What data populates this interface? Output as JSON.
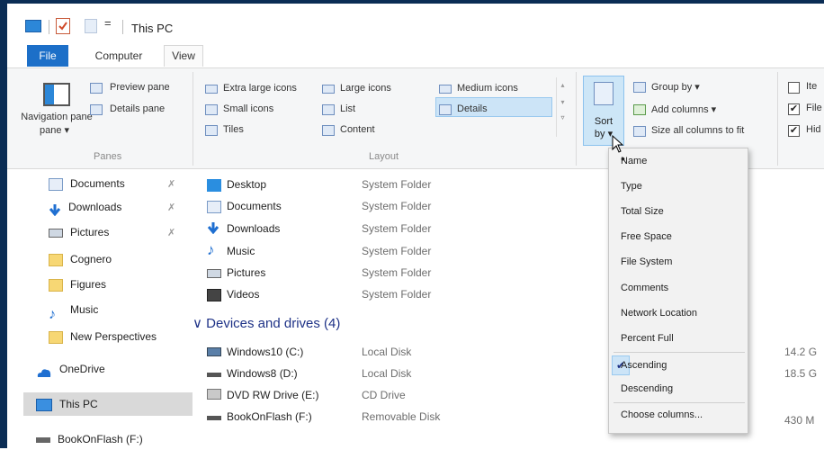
{
  "window": {
    "title": "This PC"
  },
  "tabs": {
    "file": "File",
    "computer": "Computer",
    "view": "View"
  },
  "ribbon": {
    "panes": {
      "navigation_pane": "Navigation pane",
      "navigation_pane_arrow": "▾",
      "preview_pane": "Preview pane",
      "details_pane": "Details pane",
      "group_label": "Panes"
    },
    "layout": {
      "extra_large_icons": "Extra large icons",
      "large_icons": "Large icons",
      "medium_icons": "Medium icons",
      "small_icons": "Small icons",
      "list": "List",
      "details": "Details",
      "tiles": "Tiles",
      "content": "Content",
      "group_label": "Layout",
      "selected": "Details"
    },
    "current_view": {
      "sort_by_line1": "Sort",
      "sort_by_line2": "by ▾",
      "group_by": "Group by ▾",
      "add_columns": "Add columns ▾",
      "size_all_columns": "Size all columns to fit"
    },
    "show_hide": {
      "items": [
        {
          "label": "Ite",
          "checked": false
        },
        {
          "label": "File",
          "checked": true
        },
        {
          "label": "Hid",
          "checked": true
        }
      ]
    }
  },
  "nav": {
    "items": [
      {
        "label": "Documents",
        "pinned": true,
        "icon": "documents-icon"
      },
      {
        "label": "Downloads",
        "pinned": true,
        "icon": "downloads-icon"
      },
      {
        "label": "Pictures",
        "pinned": true,
        "icon": "pictures-icon"
      },
      {
        "label": "Cognero",
        "pinned": false,
        "icon": "folder-icon"
      },
      {
        "label": "Figures",
        "pinned": false,
        "icon": "folder-icon"
      },
      {
        "label": "Music",
        "pinned": false,
        "icon": "music-icon"
      },
      {
        "label": "New Perspectives",
        "pinned": false,
        "icon": "folder-icon"
      },
      {
        "label": "OneDrive",
        "pinned": false,
        "icon": "onedrive-icon"
      },
      {
        "label": "This PC",
        "pinned": false,
        "icon": "this-pc-icon",
        "selected": true
      },
      {
        "label": "BookOnFlash (F:)",
        "pinned": false,
        "icon": "drive-icon"
      }
    ],
    "pin_glyph": "✗"
  },
  "content": {
    "folders": [
      {
        "name": "Desktop",
        "type": "System Folder",
        "icon": "desktop-icon"
      },
      {
        "name": "Documents",
        "type": "System Folder",
        "icon": "documents-icon"
      },
      {
        "name": "Downloads",
        "type": "System Folder",
        "icon": "downloads-icon"
      },
      {
        "name": "Music",
        "type": "System Folder",
        "icon": "music-icon"
      },
      {
        "name": "Pictures",
        "type": "System Folder",
        "icon": "pictures-icon"
      },
      {
        "name": "Videos",
        "type": "System Folder",
        "icon": "videos-icon"
      }
    ],
    "devices_header": "Devices and drives (4)",
    "devices_chevron": "∨",
    "drives": [
      {
        "name": "Windows10 (C:)",
        "type": "Local Disk",
        "size": "14.2 G"
      },
      {
        "name": "Windows8 (D:)",
        "type": "Local Disk",
        "size": "18.5 G"
      },
      {
        "name": "DVD RW Drive (E:)",
        "type": "CD Drive",
        "size": ""
      },
      {
        "name": "BookOnFlash (F:)",
        "type": "Removable Disk",
        "size": "430 M"
      }
    ]
  },
  "sort_menu": {
    "items": [
      "Name",
      "Type",
      "Total Size",
      "Free Space",
      "File System",
      "Comments",
      "Network Location",
      "Percent Full"
    ],
    "selected_item": "Name",
    "order_items": [
      "Ascending",
      "Descending"
    ],
    "selected_order": "Ascending",
    "choose_columns": "Choose columns...",
    "bullet": "•",
    "check": "✔"
  },
  "colors": {
    "accent": "#1c6fc8",
    "selection": "#cce4f7",
    "group_header": "#1e3287",
    "frame": "#0b2d55"
  }
}
